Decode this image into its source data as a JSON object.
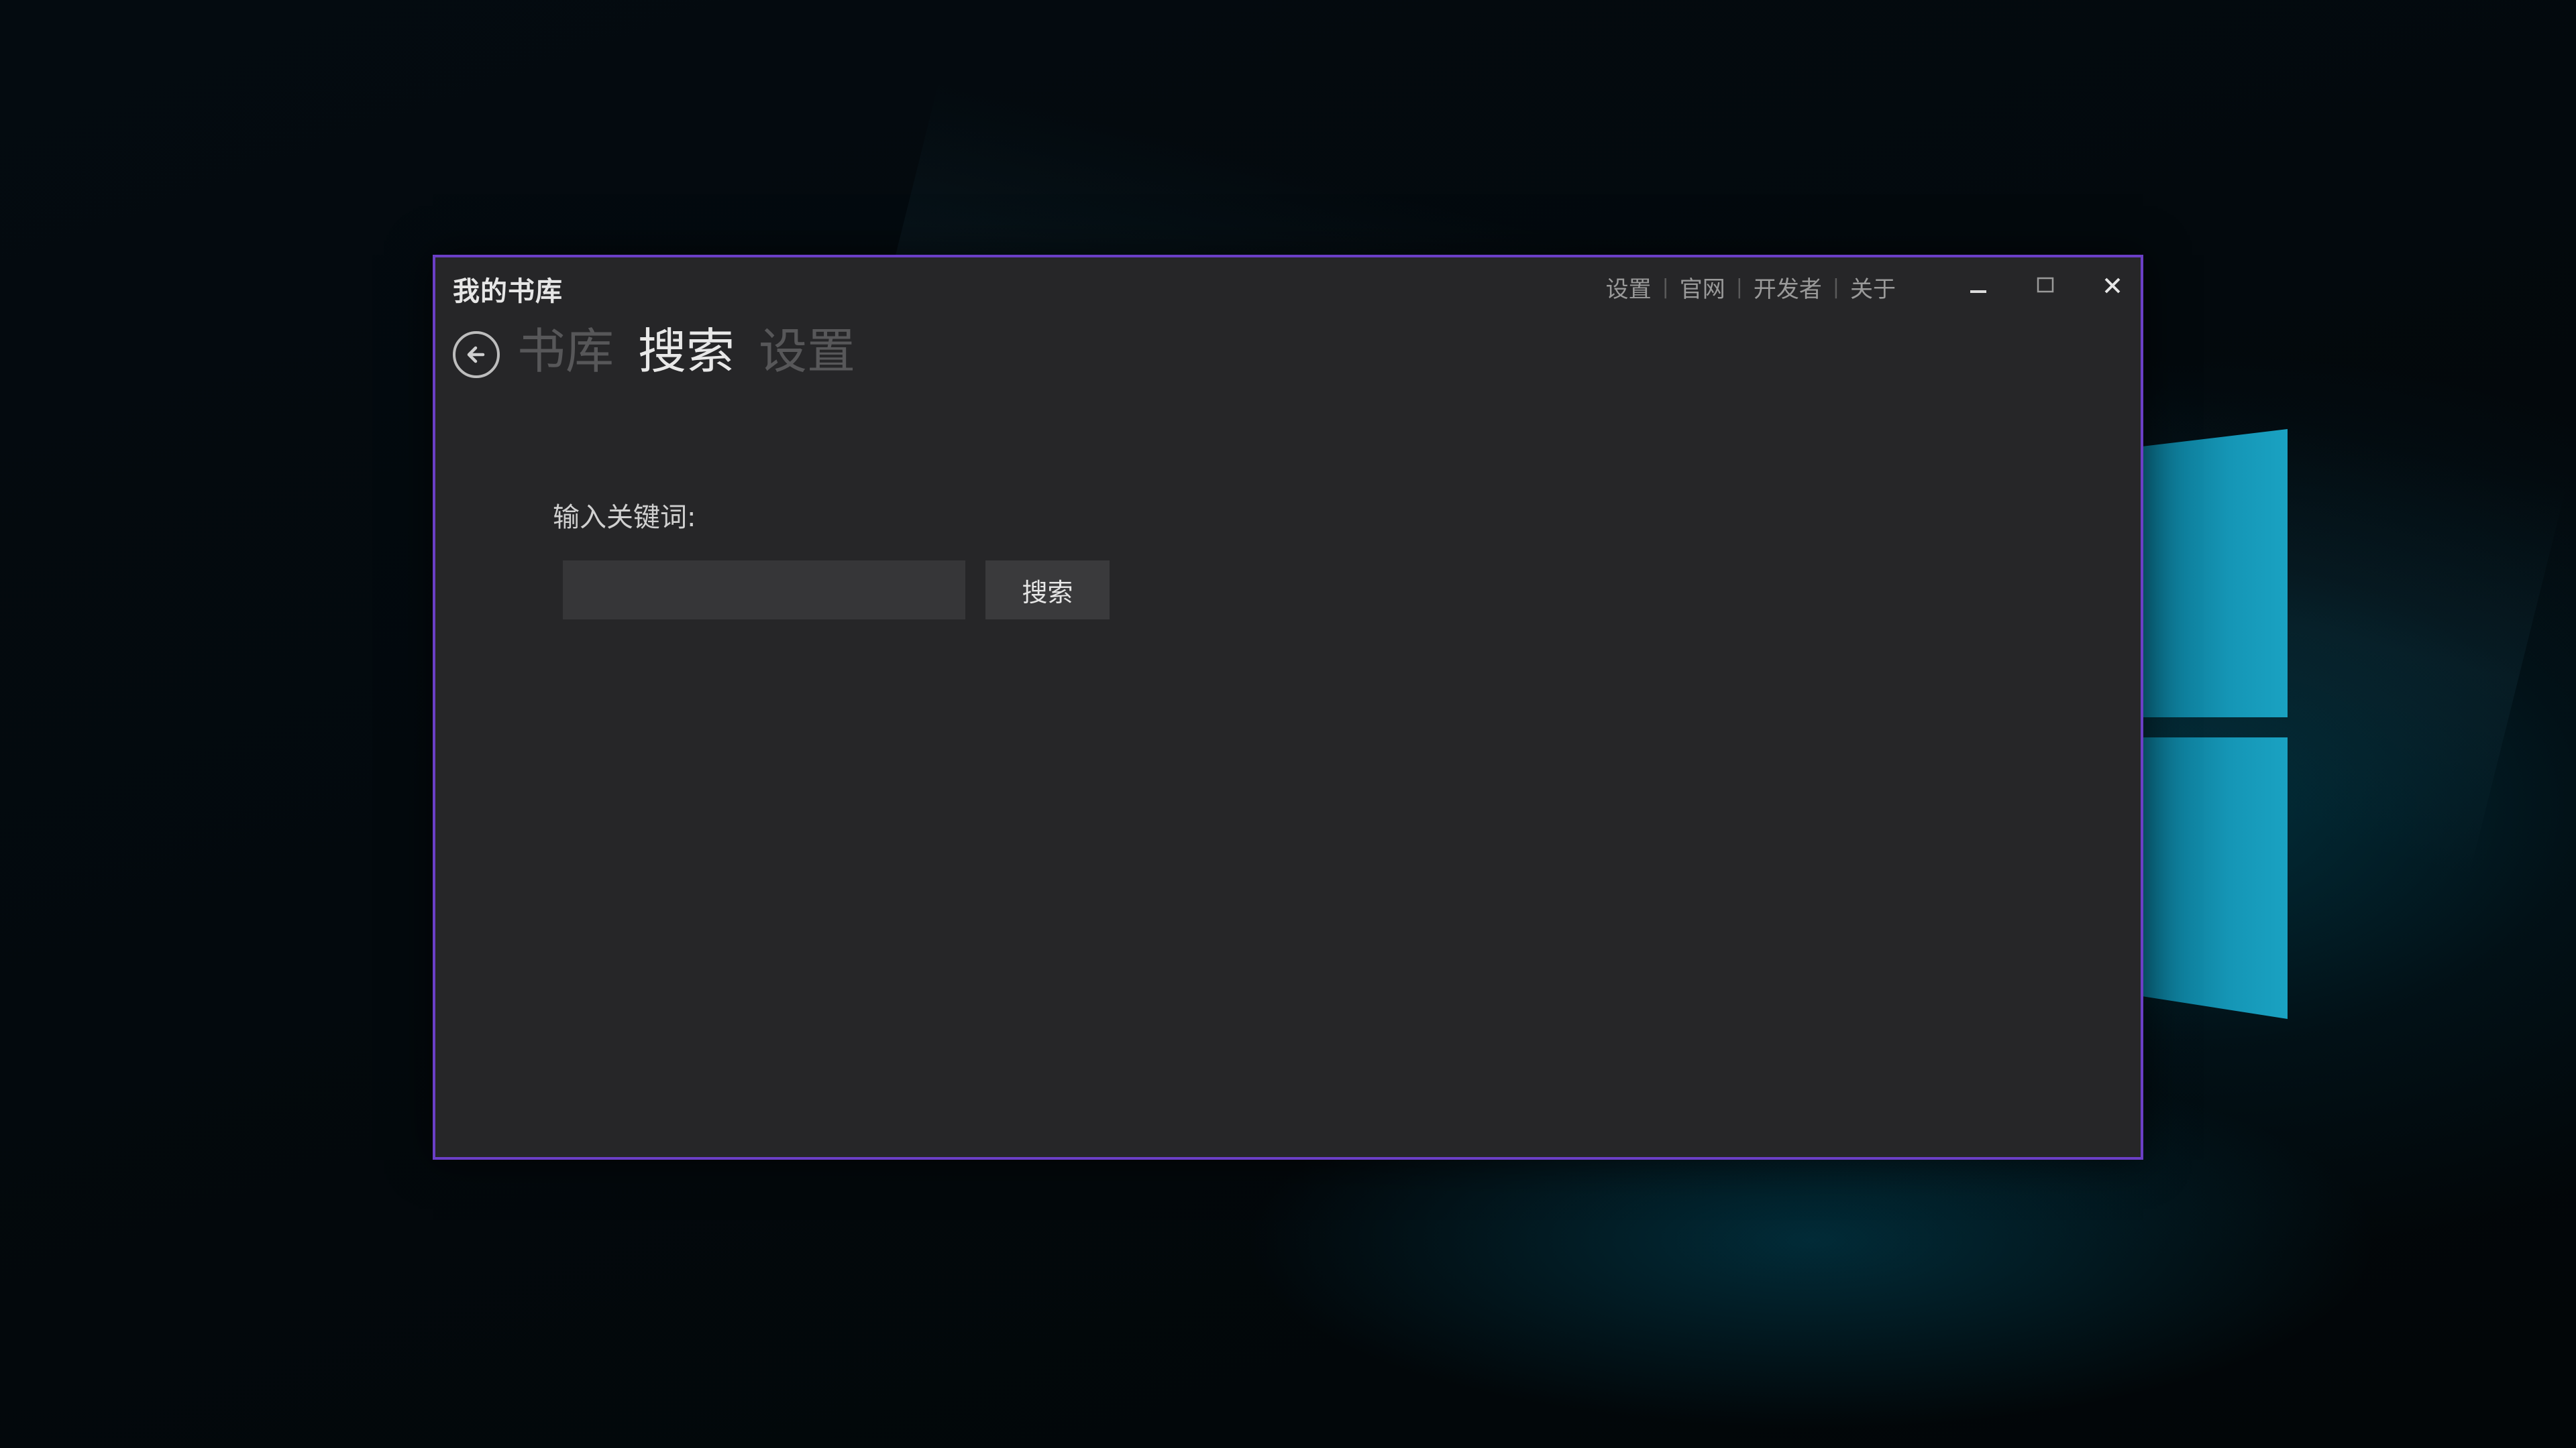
{
  "window": {
    "title": "我的书库"
  },
  "top_links": [
    {
      "label": "设置"
    },
    {
      "label": "官网"
    },
    {
      "label": "开发者"
    },
    {
      "label": "关于"
    }
  ],
  "top_link_separator": "|",
  "window_controls": {
    "minimize_icon": "minimize-icon",
    "maximize_icon": "maximize-icon",
    "close_icon": "close-icon"
  },
  "nav": {
    "back_icon": "arrow-left-circle-icon",
    "tabs": [
      {
        "label": "书库",
        "active": false
      },
      {
        "label": "搜索",
        "active": true
      },
      {
        "label": "设置",
        "active": false
      }
    ]
  },
  "search": {
    "label": "输入关键词:",
    "input_value": "",
    "button_label": "搜索"
  },
  "colors": {
    "window_border": "#6b3fc6",
    "window_bg": "#262628",
    "desktop_accent": "#1596b6"
  }
}
